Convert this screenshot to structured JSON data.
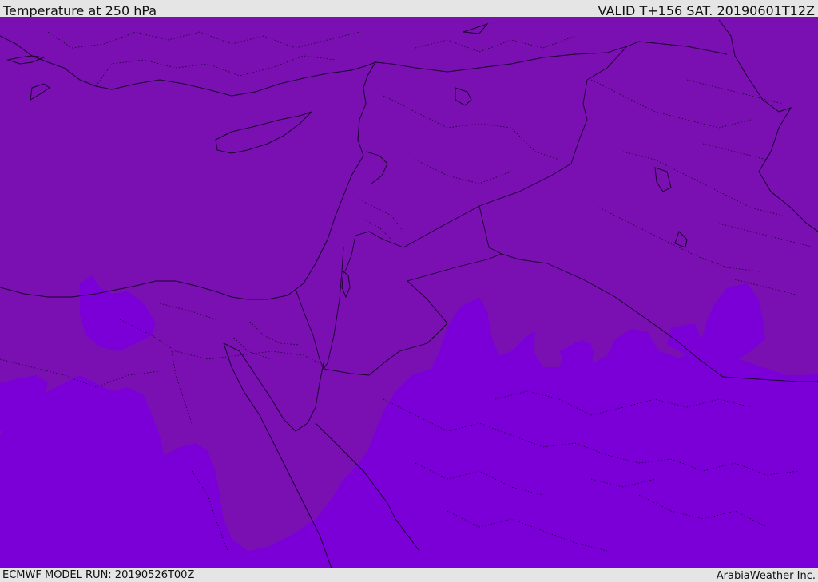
{
  "header": {
    "title": "Temperature at 250 hPa",
    "valid": "VALID T+156 SAT. 20190601T12Z"
  },
  "footer": {
    "model_run": "ECMWF MODEL RUN: 20190526T00Z",
    "credit": "ArabiaWeather Inc."
  },
  "colors": {
    "cooler_band": "#7a10b2",
    "warmer_band": "#7b00d8",
    "outline": "#1a0030",
    "frame": "#e5e5e5"
  }
}
